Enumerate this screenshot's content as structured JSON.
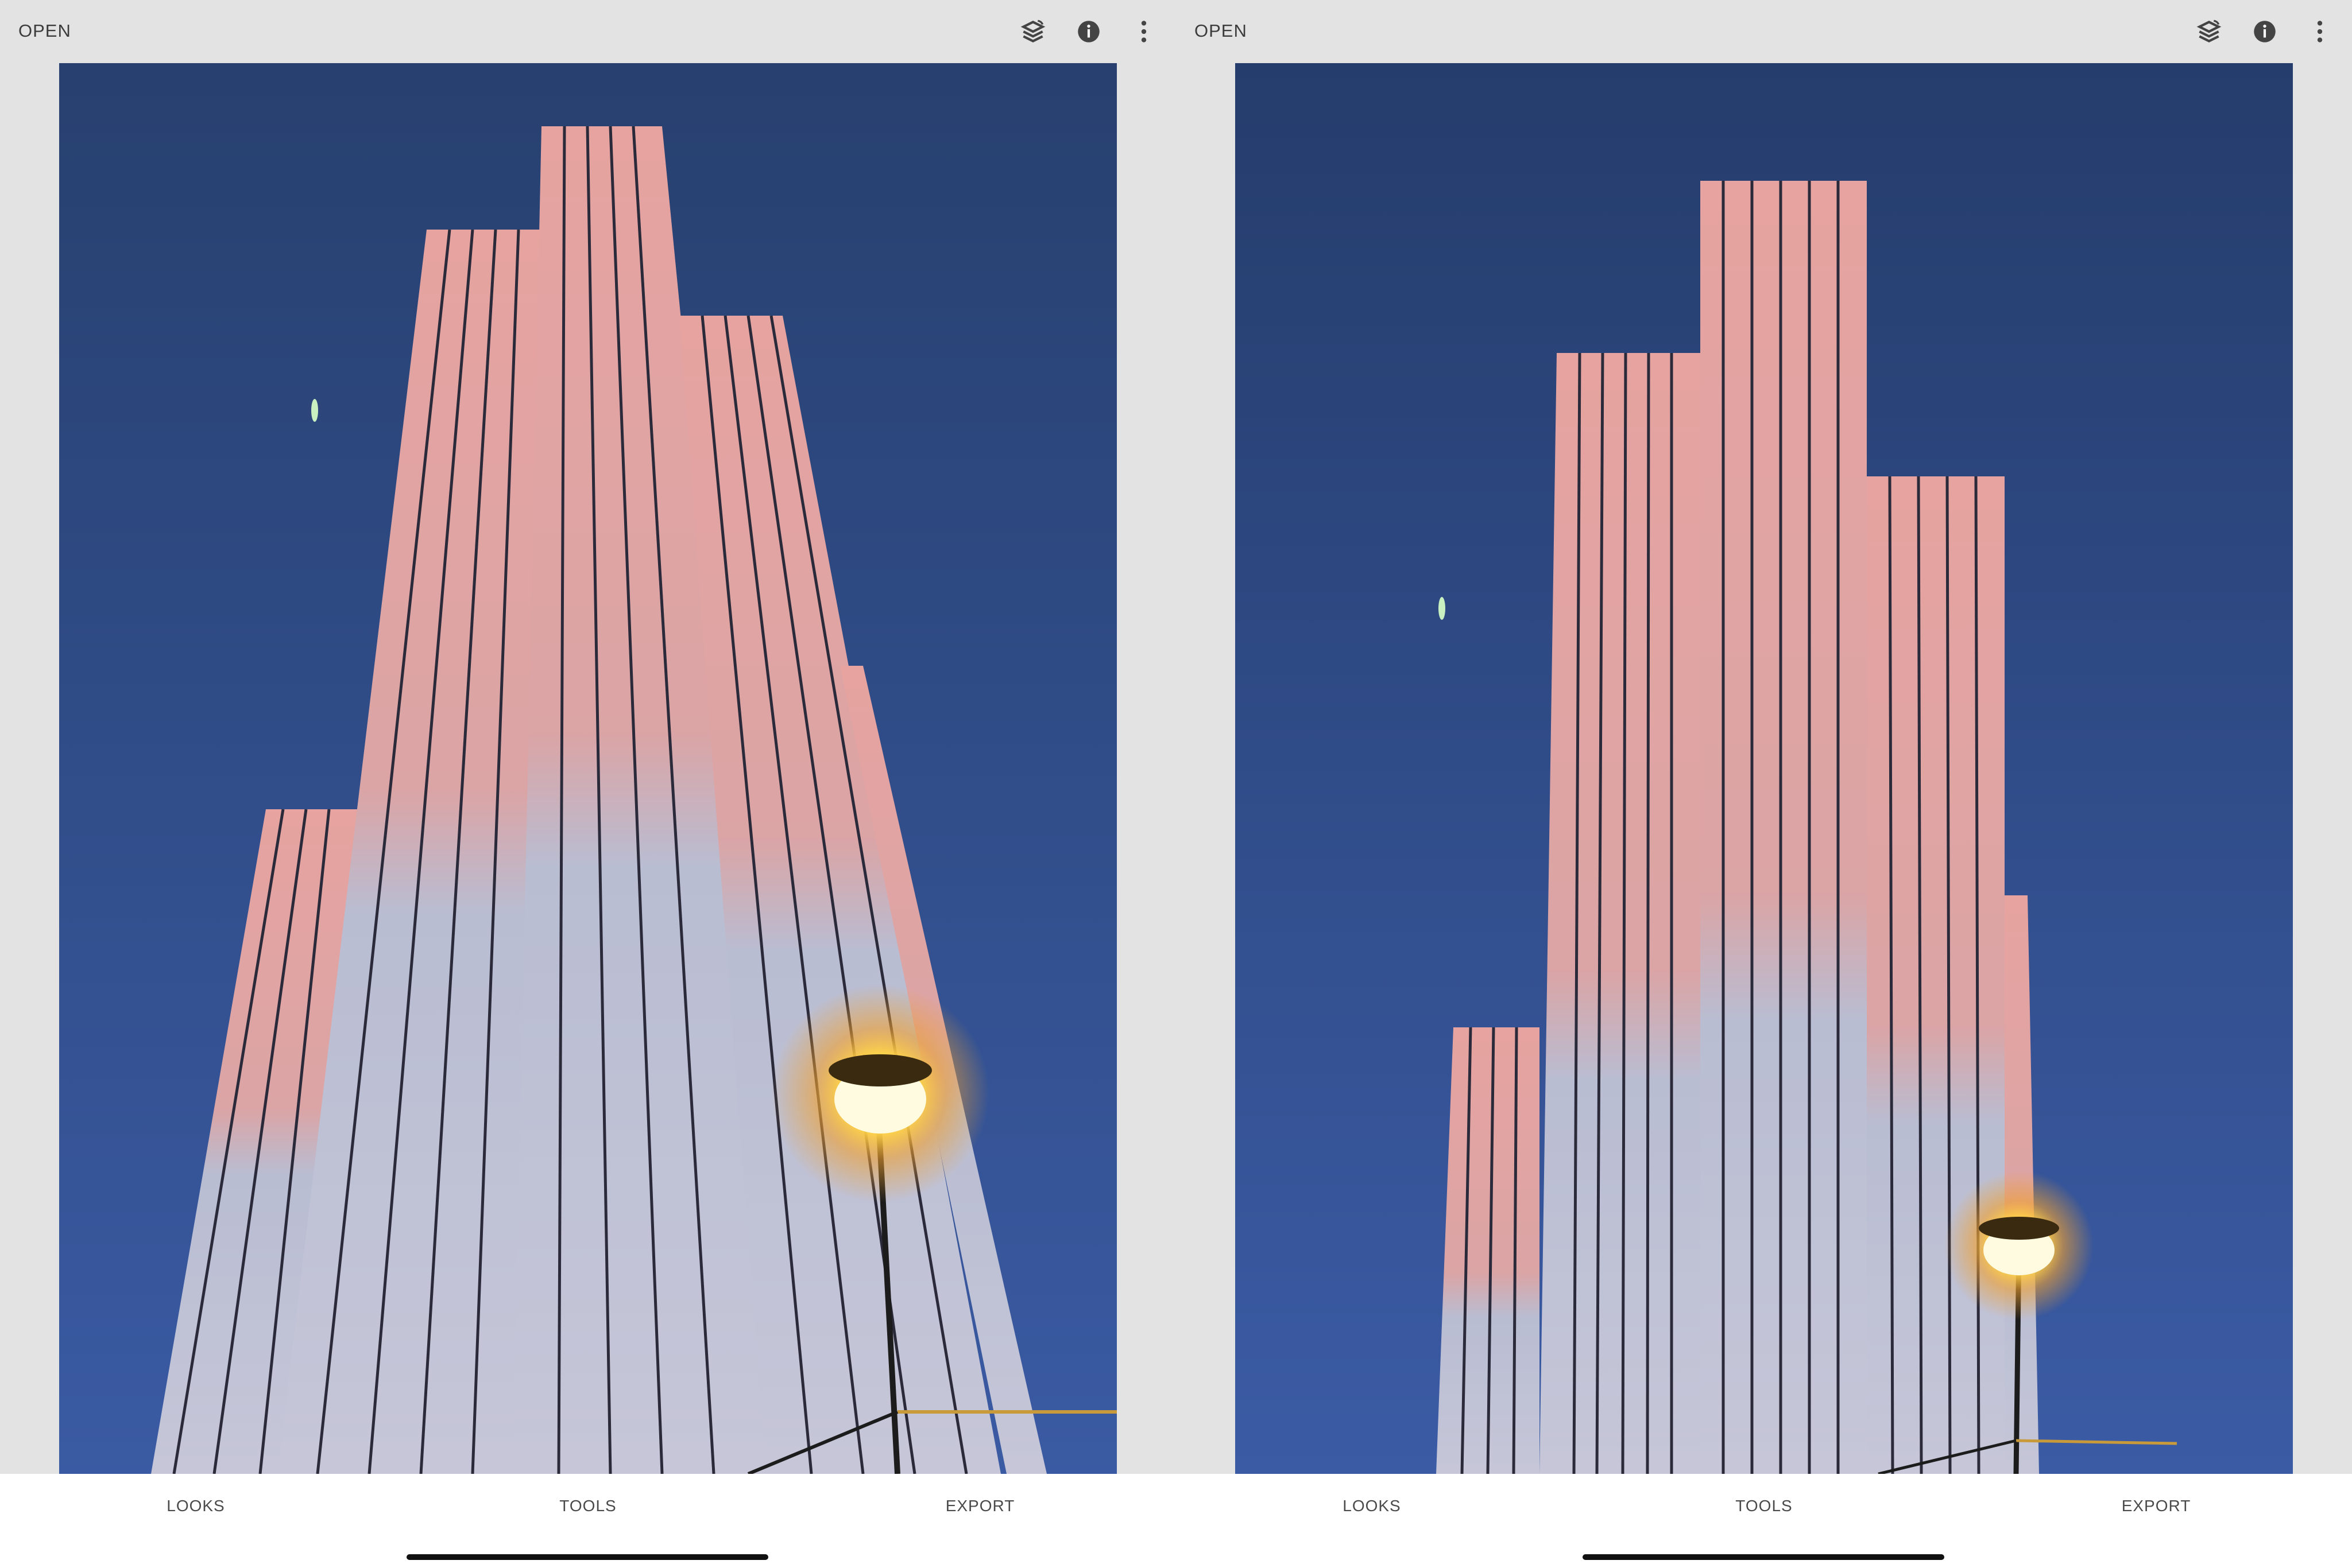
{
  "panes": [
    {
      "toolbar": {
        "open_label": "OPEN",
        "icons": [
          "edit-stack-icon",
          "info-icon",
          "more-vert-icon"
        ]
      },
      "photo": {
        "subject": "building-towers-with-street-lamp"
      },
      "tabs": {
        "looks": "LOOKS",
        "tools": "TOOLS",
        "export": "EXPORT"
      }
    },
    {
      "toolbar": {
        "open_label": "OPEN",
        "icons": [
          "edit-stack-icon",
          "info-icon",
          "more-vert-icon"
        ]
      },
      "photo": {
        "subject": "building-towers-with-street-lamp"
      },
      "tabs": {
        "looks": "LOOKS",
        "tools": "TOOLS",
        "export": "EXPORT"
      }
    }
  ],
  "colors": {
    "toolbar_bg": "#e3e3e3",
    "sky": "#2d4a86",
    "building_pink": "#d9a09c",
    "building_shadow": "#b8bfd2",
    "lamp_glow": "#ffd24a",
    "text": "#3c3c3c"
  }
}
